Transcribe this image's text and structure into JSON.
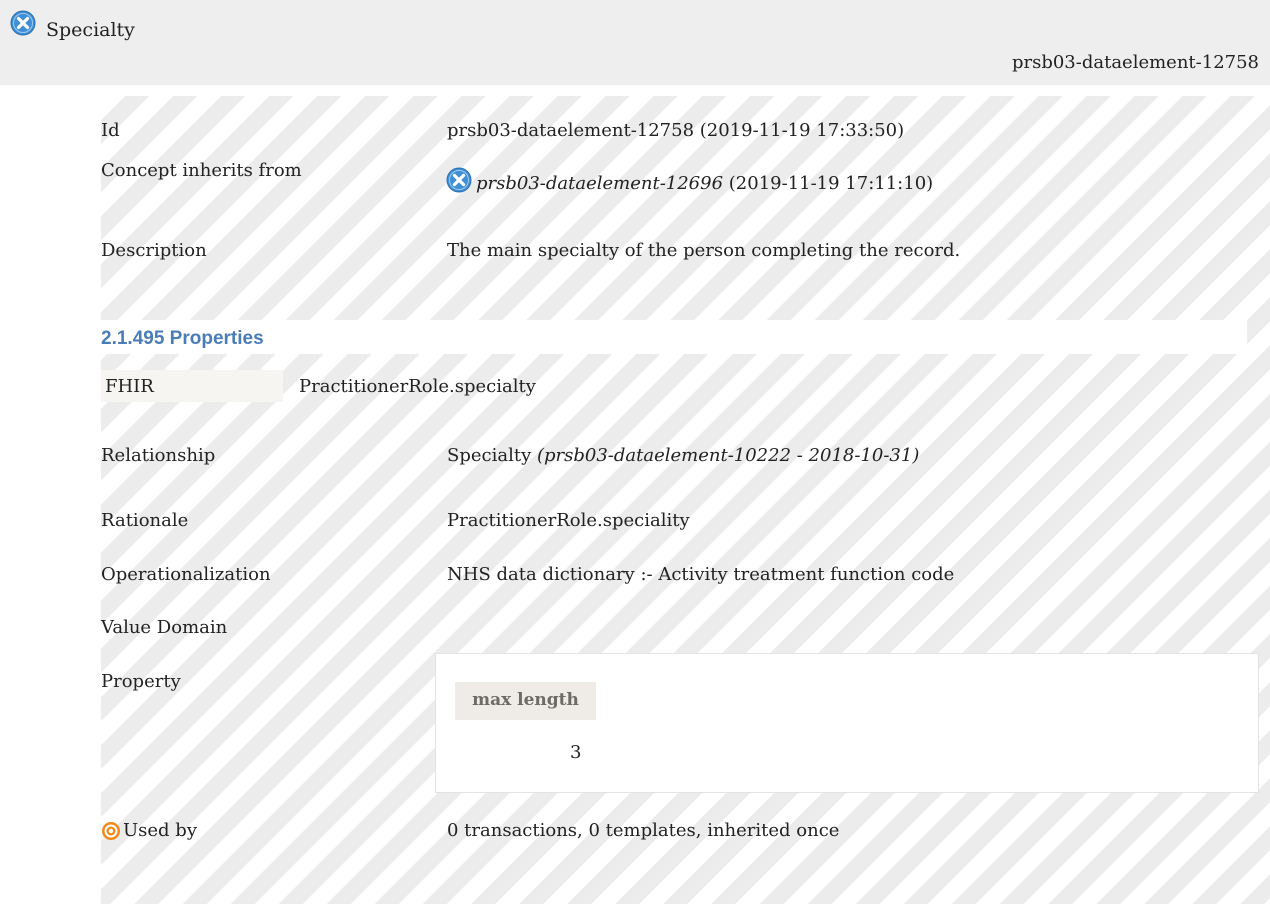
{
  "header": {
    "title": "Specialty",
    "reference": "prsb03-dataelement-12758"
  },
  "fields": {
    "id": {
      "label": "Id",
      "value": "prsb03-dataelement-12758 (2019-11-19 17:33:50)"
    },
    "inherits": {
      "label": "Concept inherits from",
      "link": "prsb03-dataelement-12696",
      "date": "(2019-11-19 17:11:10)"
    },
    "description": {
      "label": "Description",
      "value": "The main specialty of the person completing the record."
    }
  },
  "properties": {
    "heading": "2.1.495 Properties",
    "fhir": {
      "label": "FHIR",
      "value": "PractitionerRole.specialty"
    },
    "relationship": {
      "label": "Relationship",
      "value": "Specialty",
      "ref": "(prsb03-dataelement-10222 - 2018-10-31)"
    },
    "rationale": {
      "label": "Rationale",
      "value": "PractitionerRole.speciality"
    },
    "operationalization": {
      "label": "Operationalization",
      "value": "NHS data dictionary :- Activity treatment function code"
    },
    "value_domain": {
      "label": "Value Domain"
    },
    "property": {
      "label": "Property",
      "column_header": "max length",
      "column_value": "3"
    },
    "used_by": {
      "label": "Used by",
      "value": "0 transactions, 0 templates, inherited once"
    }
  },
  "colors": {
    "section_heading": "#4a7db8",
    "icon_blue": "#3f8fd6",
    "icon_orange": "#f08a1c"
  }
}
